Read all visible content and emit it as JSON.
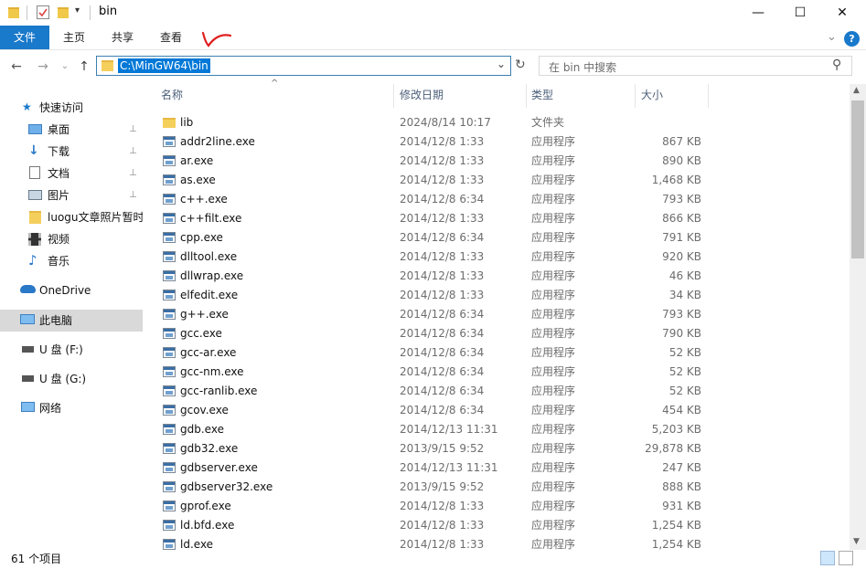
{
  "window": {
    "title": "bin",
    "min_label": "—",
    "max_label": "☐",
    "close_label": "✕"
  },
  "ribbon": {
    "tabs": [
      "文件",
      "主页",
      "共享",
      "查看"
    ],
    "expand": "⌄",
    "help": "?"
  },
  "nav": {
    "back": "←",
    "forward": "→",
    "recent": "⌄",
    "up": "↑",
    "address": "C:\\MinGW64\\bin",
    "address_dropdown": "⌄",
    "refresh": "↻",
    "search_placeholder": "在 bin 中搜索",
    "search_icon": "⚲"
  },
  "sidebar": {
    "quick_access": "快速访问",
    "items": [
      {
        "label": "桌面",
        "icon": "desktop-icon",
        "pinned": true
      },
      {
        "label": "下载",
        "icon": "download-icon",
        "pinned": true
      },
      {
        "label": "文档",
        "icon": "document-icon",
        "pinned": true
      },
      {
        "label": "图片",
        "icon": "pictures-icon",
        "pinned": true
      },
      {
        "label": "luogu文章照片暂时",
        "icon": "folder-icon",
        "pinned": false
      },
      {
        "label": "视频",
        "icon": "video-icon",
        "pinned": false
      },
      {
        "label": "音乐",
        "icon": "music-icon",
        "pinned": false
      }
    ],
    "onedrive": "OneDrive",
    "this_pc": "此电脑",
    "drive_f": "U 盘 (F:)",
    "drive_g": "U 盘 (G:)",
    "network": "网络",
    "pin_glyph": "📌"
  },
  "columns": {
    "name": "名称",
    "date": "修改日期",
    "type": "类型",
    "size": "大小",
    "sort_glyph": "^"
  },
  "files": [
    {
      "name": "lib",
      "date": "2024/8/14 10:17",
      "type": "文件夹",
      "size": "",
      "kind": "folder"
    },
    {
      "name": "addr2line.exe",
      "date": "2014/12/8 1:33",
      "type": "应用程序",
      "size": "867 KB",
      "kind": "exe"
    },
    {
      "name": "ar.exe",
      "date": "2014/12/8 1:33",
      "type": "应用程序",
      "size": "890 KB",
      "kind": "exe"
    },
    {
      "name": "as.exe",
      "date": "2014/12/8 1:33",
      "type": "应用程序",
      "size": "1,468 KB",
      "kind": "exe"
    },
    {
      "name": "c++.exe",
      "date": "2014/12/8 6:34",
      "type": "应用程序",
      "size": "793 KB",
      "kind": "exe"
    },
    {
      "name": "c++filt.exe",
      "date": "2014/12/8 1:33",
      "type": "应用程序",
      "size": "866 KB",
      "kind": "exe"
    },
    {
      "name": "cpp.exe",
      "date": "2014/12/8 6:34",
      "type": "应用程序",
      "size": "791 KB",
      "kind": "exe"
    },
    {
      "name": "dlltool.exe",
      "date": "2014/12/8 1:33",
      "type": "应用程序",
      "size": "920 KB",
      "kind": "exe"
    },
    {
      "name": "dllwrap.exe",
      "date": "2014/12/8 1:33",
      "type": "应用程序",
      "size": "46 KB",
      "kind": "exe"
    },
    {
      "name": "elfedit.exe",
      "date": "2014/12/8 1:33",
      "type": "应用程序",
      "size": "34 KB",
      "kind": "exe"
    },
    {
      "name": "g++.exe",
      "date": "2014/12/8 6:34",
      "type": "应用程序",
      "size": "793 KB",
      "kind": "exe"
    },
    {
      "name": "gcc.exe",
      "date": "2014/12/8 6:34",
      "type": "应用程序",
      "size": "790 KB",
      "kind": "exe"
    },
    {
      "name": "gcc-ar.exe",
      "date": "2014/12/8 6:34",
      "type": "应用程序",
      "size": "52 KB",
      "kind": "exe"
    },
    {
      "name": "gcc-nm.exe",
      "date": "2014/12/8 6:34",
      "type": "应用程序",
      "size": "52 KB",
      "kind": "exe"
    },
    {
      "name": "gcc-ranlib.exe",
      "date": "2014/12/8 6:34",
      "type": "应用程序",
      "size": "52 KB",
      "kind": "exe"
    },
    {
      "name": "gcov.exe",
      "date": "2014/12/8 6:34",
      "type": "应用程序",
      "size": "454 KB",
      "kind": "exe"
    },
    {
      "name": "gdb.exe",
      "date": "2014/12/13 11:31",
      "type": "应用程序",
      "size": "5,203 KB",
      "kind": "exe"
    },
    {
      "name": "gdb32.exe",
      "date": "2013/9/15 9:52",
      "type": "应用程序",
      "size": "29,878 KB",
      "kind": "exe"
    },
    {
      "name": "gdbserver.exe",
      "date": "2014/12/13 11:31",
      "type": "应用程序",
      "size": "247 KB",
      "kind": "exe"
    },
    {
      "name": "gdbserver32.exe",
      "date": "2013/9/15 9:52",
      "type": "应用程序",
      "size": "888 KB",
      "kind": "exe"
    },
    {
      "name": "gprof.exe",
      "date": "2014/12/8 1:33",
      "type": "应用程序",
      "size": "931 KB",
      "kind": "exe"
    },
    {
      "name": "ld.bfd.exe",
      "date": "2014/12/8 1:33",
      "type": "应用程序",
      "size": "1,254 KB",
      "kind": "exe"
    },
    {
      "name": "ld.exe",
      "date": "2014/12/8 1:33",
      "type": "应用程序",
      "size": "1,254 KB",
      "kind": "exe"
    }
  ],
  "status": {
    "count": "61 个项目"
  },
  "colors": {
    "accent": "#1979ca",
    "selection": "#0078d7",
    "sidebar_selected": "#d9d9d9",
    "annotation": "#e02020"
  }
}
